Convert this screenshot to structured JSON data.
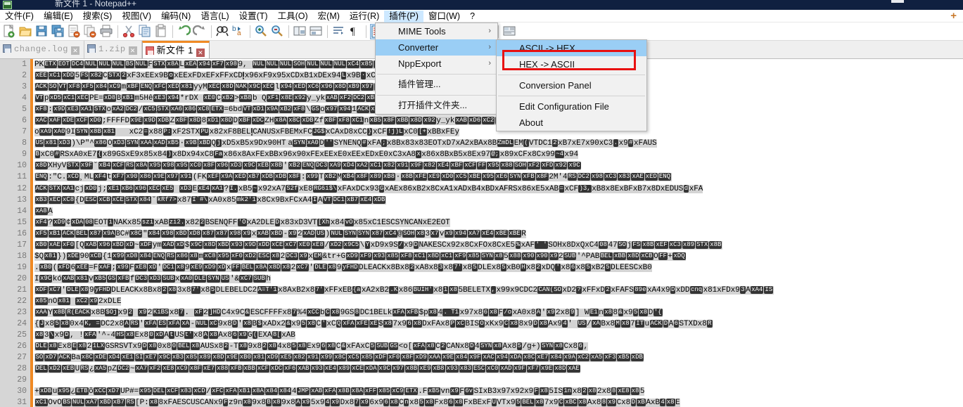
{
  "window": {
    "title": "新文件 1 - Notepad++",
    "icon": "notepad-plus-plus-icon"
  },
  "menubar": {
    "items": [
      {
        "label": "文件(F)",
        "name": "menu-file",
        "active": false
      },
      {
        "label": "编辑(E)",
        "name": "menu-edit",
        "active": false
      },
      {
        "label": "搜索(S)",
        "name": "menu-search",
        "active": false
      },
      {
        "label": "视图(V)",
        "name": "menu-view",
        "active": false
      },
      {
        "label": "编码(N)",
        "name": "menu-encoding",
        "active": false
      },
      {
        "label": "语言(L)",
        "name": "menu-language",
        "active": false
      },
      {
        "label": "设置(T)",
        "name": "menu-settings",
        "active": false
      },
      {
        "label": "工具(O)",
        "name": "menu-tools",
        "active": false
      },
      {
        "label": "宏(M)",
        "name": "menu-macro",
        "active": false
      },
      {
        "label": "运行(R)",
        "name": "menu-run",
        "active": false
      },
      {
        "label": "插件(P)",
        "name": "menu-plugins",
        "active": true
      },
      {
        "label": "窗口(W)",
        "name": "menu-window",
        "active": false
      },
      {
        "label": "?",
        "name": "menu-help",
        "active": false
      }
    ],
    "plus_label": "+"
  },
  "toolbar": {
    "icons": [
      "new-file-icon",
      "open-file-icon",
      "save-icon",
      "save-all-icon",
      "close-file-icon",
      "close-all-icon",
      "print-icon",
      "cut-icon",
      "copy-icon",
      "paste-icon",
      "undo-icon",
      "redo-icon",
      "find-icon",
      "replace-icon",
      "zoom-in-icon",
      "zoom-out-icon",
      "sync-vertical-scroll-icon",
      "sync-horizontal-scroll-icon",
      "word-wrap-icon",
      "show-all-characters-icon",
      "indent-guide-icon",
      "user-defined-dialog-icon",
      "show-document-map-icon",
      "function-list-icon",
      "record-macro-icon",
      "play-macro-icon",
      "play-macro-multiple-icon",
      "folder-as-workspace-icon"
    ]
  },
  "tabs": [
    {
      "label": "change.log",
      "name": "tab-change-log",
      "active": false,
      "close_label": "✕"
    },
    {
      "label": "1.zip",
      "name": "tab-1-zip",
      "active": false,
      "close_label": "✕"
    },
    {
      "label": "新文件 1",
      "name": "tab-new-file-1",
      "active": true,
      "close_label": "✕"
    }
  ],
  "plugin_menu": {
    "items": [
      {
        "label": "MIME Tools",
        "name": "menu-item-mime-tools",
        "submenu": true,
        "selected": false,
        "arrow": "›"
      },
      {
        "label": "Converter",
        "name": "menu-item-converter",
        "submenu": true,
        "selected": true,
        "arrow": "›"
      },
      {
        "label": "NppExport",
        "name": "menu-item-nppexport",
        "submenu": true,
        "selected": false,
        "arrow": "›"
      },
      {
        "separator": true
      },
      {
        "label": "插件管理...",
        "name": "menu-item-plugin-admin",
        "submenu": false,
        "selected": false,
        "cjk": true
      },
      {
        "separator": true
      },
      {
        "label": "打开插件文件夹...",
        "name": "menu-item-open-plugins-folder",
        "submenu": false,
        "selected": false,
        "cjk": true
      }
    ]
  },
  "converter_submenu": {
    "items": [
      {
        "label": "ASCII -> HEX",
        "name": "menu-item-ascii-to-hex",
        "selected": true
      },
      {
        "label": "HEX -> ASCII",
        "name": "menu-item-hex-to-ascii",
        "selected": false,
        "annotated": true
      },
      {
        "separator": true
      },
      {
        "label": "Conversion Panel",
        "name": "menu-item-conversion-panel",
        "selected": false
      },
      {
        "separator": true
      },
      {
        "label": "Edit Configuration File",
        "name": "menu-item-edit-configuration-file",
        "selected": false
      },
      {
        "label": "About",
        "name": "menu-item-about",
        "selected": false
      }
    ]
  },
  "annotation": {
    "color": "#e81010",
    "target": "menu-item-hex-to-ascii"
  },
  "editor": {
    "colors": {
      "selection": "#d4d4d4",
      "control_char": "#353535",
      "bookmark_margin": "#f08a24",
      "gutter": "#d6d6d6",
      "accent": "#f08a24"
    },
    "line_numbers": [
      1,
      2,
      3,
      4,
      5,
      6,
      7,
      8,
      9,
      10,
      11,
      12,
      13,
      14,
      15,
      16,
      17,
      18,
      19,
      20,
      21,
      22,
      23,
      24,
      25,
      26,
      27,
      28,
      29,
      30,
      31
    ],
    "lines": [
      "PK|ETX||EOT||DC4||NUL||NUL||NUL||BS||NUL|F|STX||x8A|L|xEA||x94||xF7||x98|9, |NUL||NUL||NUL||SOH||NUL||NUL||NUL||xC4||x85||x96||xDD||xDD||xDD|$|xB8||xB8||xB8||ACK|www    .|xC1||x83||EOT|",
      "|xEE||xC1||xDD|5|FS||x82|C|STX||2 |xF3||xEE||x9B|    o|xEE||xFD||xEF||xFF||xCD|̧|x96||xF9||x95||xCD||xB1||xDE||x94|L|x9B|·|xC7||x89||x9E|I|xB4||xB0||xB5||xC9|I|CAN||x97||xEB|cF|SOH|",
      "|ACK||SO||VT||xF8||xF5||x84||xC9|m|xBF||ENQ||xFC||xED||x81|yyM|xEC||x8D||NAK||x9C||xEC|l|x94||xED||xC6||x96||x8D||xB9||x97||x9D||xB0|u|xB8||x83||STX||NUL||x8C||DEL||BEL|3tp` |xF4||xB0||x85||xC9|I|CAN||x97||xEB|",
      "|VT|p|xD5||xC1||xEC|PE=|xD8|B|xB1|m5Hê|xE3||x94|*rDX   |xE0|C|xB2|>|xB8|b  Q|xF1||x8E||x92|y_yk|xAB||xF2||DC2||xBF||SOH||x9D|",
      "|xF8|:|x9D||xE3||xA1||STX|o|xA2||DC2|/|xC5|̧|STX||xA6||x86||xC8||ETX|=6bd|VT||xD1||x9A||xB2||xF8|\\|GS|o|x97||x94|1|ACK||xD6|;|x9B|+|xB3|]",
      "|xAC||xAF||xDE||xCF||xD0|;FFFFD|x9E||x9D||xDB|Z|xBF||x8D|8|xD1||x8D|D|xBF||xDC|ZH|x8A||x8C||xDB|Zf|xBF||xF8||xC1|n|xB5||x8F||xBB||x8D||x92|y_yk|xAB||xD6||xC2||xF9||SOH|",
      "o|xA9||xA0|9I|SYN||x8B||x81| | | | |xC2|=|x88|P:|xF2||STX|PU|x82||xF8||BEL|̧|CAN||US||xFB||EM||xFC|JG$|xCA||xD8||xCC|}|xCF|!j)L|xC0|[+|xBB||xFE||y",
      "|US||x81||xD3|)\\P\"^|x86|O|xD3||SYN||xAA||xAD||xB5|·|x9B||xBD|Q|j|xD5||xB5||x9D||x90||HT| |a|SYN||xA0|D|''|SYN||ENQ|#|xFA|;|x8B||x83||x83||EOT||xD7||xA2||xBA||x8B|ZmDL|EM|(|VT||DC1|2|xB7||xE7||x90||xC3|.|x9|#|xFA||US|",
      "|B|xC0|#|RS||xA0||xE7|{|x89||GS||xE9||x85||x84|)|x8D||x94||xC8|Fa|x86||x8A||xFE||xBB||x96||x90||xFE||xEE||xE0||xEE||xED||xE0||xC3||xA8|x|x86||x8B||xB5||x8E||x97|@;|x89||xCF||x8C||x99|~4|x94|",
      "|x8D|XHyV|STX||x9F|˘|xB4||xCF||RS||x8A||x95||x98||x95||xC0||x8F||x96||xD3||x9C||xEB||x8B|'|xB2||ENQ||DC3||xA9||xD4||xA2||xC1||x82||x91||x9F||x82||xE4||xBF||xCF||FF||x95||x88||SOH||xF2||xFD||x92||x9C|",
      "|ENQ|:\"C.|xCD|¸ML|xF4|t|xF7||x90||x86||x9E||x97||x91|(FK|xEF||x9A||xED||xB7||xDB||xDB||x8F|:|x99|T|xB2|M|xB4||x8F||x89||xB8|·|x8B||xFE||xE9||xD0||xC5||xBE||x95||xE6||SYN||xFB||x8F|2M'4|RS||DC2||x98||xC3||x83||xAE||xED||ENQ|",
      "|ACK||STX||xA1|cj|xD0|j;|xE1||xB6||x96||xEC||xE5| |xD3|E|xE4||xA1|?|I.|xB5|~|x92||xA7|S2f|xE8|RG6i$\\|xFA||xDC||x93|G|xAE||x86||xB2||x8C||xA1||xAD||xB4||xBD||xAF||RS||x86||xE5||xAB|=|xCF|)3,|xB8||x8E||xBF||xB7||x8D||xED||US|d|xFA|",
      "|xB3||xEC||xC8|{D|ESC||xCB||xCE||STX||x84|˘|kRf7>|x87|I`#\\|xA0||x85|mk2'1|x8C||x9B||xFC||xA4|I|A|VT||DC1||xB7||xE4||xDB|",
      "|xA8|A",
      " |xF4|?|xD9|¢|xDA||08|EOT|i|NAK||x85|szi|xAB|zi2.|x82|2|BS||ENQ||FF|'O|xA2||DLE|D|x83||xD3||VT|[Xh|x84|vO|x85||xC1||ESC||SYN||CAN||xE2||EOT|",
      "|xF5||xB1||ACK||BEL||x87||x9A|BC#|x8C|\"|x84||x98||xBD||xD8||x87||x87||x98||x9|x|xAB||xBD|-|x9|2|xAD||US|)|NUL||SYN||SYN||x87||xC4|@|SOH||x8|3|x7|v|x9||x94||xA7||xE4||xBE||xBE|R",
      "|xB0||xAE||xF0|[Q|xAB||x96||xBD||xD|~|xDF|ym|xAD||xD|$|x9C||x8D||xBD||x93||x9D||xDD||xCE||xC7||xE0||xE8|/|xD2||x9C5|\\|Y|xD9||x9S|/|x9|D|NAK||ESC||x92||x8C||xFO||x8C||xE5|%|xAF|' '|SOH||x8D||xQ||xC4|08|47|SO|j|FS||x8B||xEF||xC3||x89||STX||x8B|",
      "$Q|x81|})|xDE|90|xCB|{1|x99||xD8||x84||ENQ||RS||x86||x8|m|xC8||x95||xF0||xD2||ESC||x8|2|DC3||x9|x|EM|&tr+G|xD9||xF9||x93||x85||xF8||xC1||x8D||xC1||xF9||x85||SYN||x8|5|x88||x90||x90||x9|2|SUB|'^PAB|BEL||xBB||x8D||xCB|O|FF|+|xDQ|",
      ".|xB0|(|xFD|6|xEE|=F|xAF|;|x99|F|xE8||xD|'|DC1||x8|9|xE9||xD9||xD|x|FF||BEL||x8A||x8D||x8|2|xC7|'|DLE||x8|9|yFHD|DLE||ACK||x8B||x8|2|xA8||x8|3|x8|7'|x8|5|DLE||x8|5|xB0|H|x8|2|xDQ|'|x8|6|x8|5|xB2|5|DLE||ESC||xB0|",
      "I|x9C|kó|xAB||x81|v|xB5||GS||xFB|f|DC3||xD3||SUB|x|xA0||DLE||SYN||US|'&|xC7||SUB|h",
      "|xDF||xC7|'|DLE||x8|9|yFHD|DLE||ACK||x8B||x8|2||x8|3||x8|7'|x8|5|DLE||BEL||DC2|A=T'1|x8A||xB2||x8|7'|xFF||xEB|{a|xA2||xB2|.K|x86|BUIH'|x8|1||x8|5||BEL||ETX|,|x99||x9C||DC2|CAN(SO|xD2|?|xFF||xD|2|xFA||FS|89e|xA4||x9|D|xDD|cnq|x81||xFD||x9|3|A|xA4||IS|",
      "|x85|nO|x81|     |xC2||x9|2||xDLE|",
      "|xAA|Y|x8B||R(EACK|x8B|$Oj|x9|2|    |x9|2|KiBS|x8|7|. |xF|2|]HD|C4||x9C|&|ESC||FF||FF||x8|7|%4|xCC|b|C||x8|9||GS|8|DC1||BEL||k|xFA||xFB|$p|x8|4|. T1|x97||x8|6||x8|F|/o|xA0||x8|A|'|x9|2||x8|9|] W|E1|n|x8|8|&|x9|5||x8|D|'{",
      "{|J|x8|5||x8|0||x4|K, =|DC2||x8|A||RS|'|xFA||ES||xFA||xA|-|NUL||xC|9||x8|D|'|x8|B|$|xAD||x2|&|x9|5||x8|C|'|xC|Q||xFA||xFE||xE|$|x8|7||x9|6||x8|D||xFA||x8|P||xC|B||IS|O|xK||x9|C||x8|8||x9|D||x8|A||x9|4|' |US|/|xA|B||x8|M||x8|7|IT|u|ACK||D|A|6|STX||D||x8|R|",
      "|x8|3|\\|x9|D|, !|xFA|'^-4|HS||x8|E||x8|0||xD|A|t|US|t'|x8|A||x8|A||x8|6||x9|G|(|EXA|8[|xAB|",
      "|DLE||x8|E||x8|E||x8|2|1LX|GS||RS||VT||x9|D||x8|0||x8|0||BEL||x8|A||US||x8|2|-T|x8|9||x8|2||x8|4||x8|5||x8|E||x9|6||x8|C|&|xFA||xC|5||SUB||GS|<o[|xFA||x8|C|2|CAN||x8|D|4|SYN||x8|A||x8|5|/g+)|SYN||x8|C||x8|6|,",
      "|SO||xD7||ACK|Ba|x8C||xDE||xD4||xE1||SI||xE7||x9C||xB3||x85||x89||x8D||x9E||xB0||x81||xD9||xE5||x82||x91||x99||x8C||xC5||x85||xDF||xF0||x8F||xD9||xAA||x9E||x84||x9F||xAC||x94||xDA||x8C||xE7||x84||x9A||xC2||xA5||xF3||xB5||xDB|",
      "|DEL||xD2||xEB|U|RS|¿|xA5|pZ|DC2|~|xA7||xF2||xE8||xC9||x8F||xE7||x88||xFB||xBB||xCF||xDC||xF6||xAB||x93||xE4||x89||xCE||xDA||x9C||x97||x8B||xE9||xB8||x93||x83||ESC||xC0||xAD||x9F||xF7||x9E||x8D||xAE|",
      "",
      "+|xDB|u|x95|¿|ETB|õ|xCC||xD7|UP#=|x95||DEL||xCF||x83||xCD|/|xFC||xFA||xB1||x8A||x84||x84|4|JMP||xAB||xFA||x8B||x8A||xFF||x85||xC9||ETX|.F|xB5|vn|x9|F|6v|SI||xB3||x97||x92||x9|F||x8|5||IS|1n|x8|2||x8|2||x8|8||xE8||x8|5|",
      "|xC1|OvO|BS||NUL||xA7||xBD||xB7||RS|[P:|x8|8||xFA||ESC||US||CAN||x9|F|z9n|x8|9||x8|B||x8|9||x8|A||x9|5||x9|4||x9|D||x8|7||x9|6||x9|6||x8|C|n|x8|5||x8|F||x8|6||x8|F||xBE||xF|U|VT||x9|5||BEL||x8|7||x9|C||xBC||x8|A||x8|8||x9|C||x8|D||xB|A||xB|4||x8|E|"
    ]
  }
}
